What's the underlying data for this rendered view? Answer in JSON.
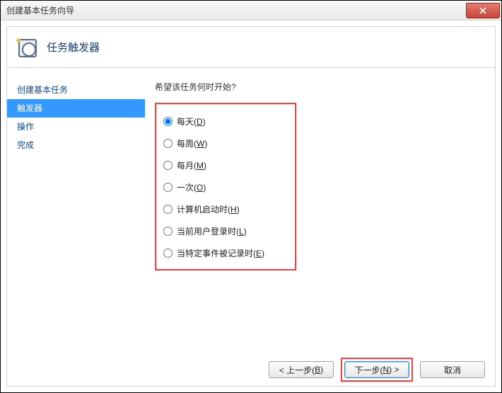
{
  "window": {
    "title": "创建基本任务向导"
  },
  "header": {
    "title": "任务触发器"
  },
  "sidebar": {
    "items": [
      {
        "label": "创建基本任务",
        "active": false
      },
      {
        "label": "触发器",
        "active": true
      },
      {
        "label": "操作",
        "active": false
      },
      {
        "label": "完成",
        "active": false
      }
    ]
  },
  "main": {
    "question": "希望该任务何时开始?",
    "options": [
      {
        "text": "每天",
        "key": "D",
        "selected": true
      },
      {
        "text": "每周",
        "key": "W",
        "selected": false
      },
      {
        "text": "每月",
        "key": "M",
        "selected": false
      },
      {
        "text": "一次",
        "key": "O",
        "selected": false
      },
      {
        "text": "计算机启动时",
        "key": "H",
        "selected": false
      },
      {
        "text": "当前用户登录时",
        "key": "L",
        "selected": false
      },
      {
        "text": "当特定事件被记录时",
        "key": "E",
        "selected": false
      }
    ]
  },
  "footer": {
    "back_prefix": "< 上一步(",
    "back_key": "B",
    "back_suffix": ")",
    "next_prefix": "下一步(",
    "next_key": "N",
    "next_suffix": ") >",
    "cancel": "取消"
  }
}
